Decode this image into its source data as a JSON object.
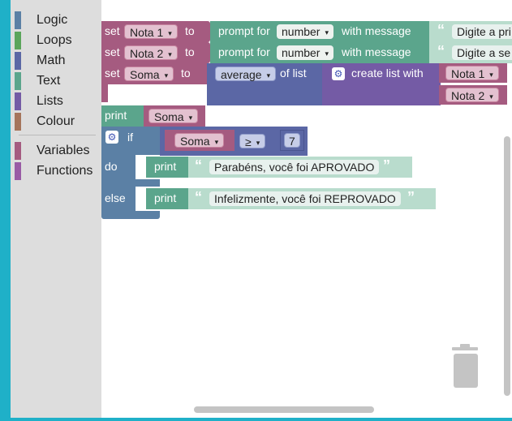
{
  "toolbox": {
    "categories": [
      {
        "label": "Logic",
        "color": "#5b80a5"
      },
      {
        "label": "Loops",
        "color": "#5ba55b"
      },
      {
        "label": "Math",
        "color": "#5b67a5"
      },
      {
        "label": "Text",
        "color": "#5ba58c"
      },
      {
        "label": "Lists",
        "color": "#745ba5"
      },
      {
        "label": "Colour",
        "color": "#a5745b"
      },
      {
        "label": "Variables",
        "color": "#a55b80"
      },
      {
        "label": "Functions",
        "color": "#995ba5"
      }
    ]
  },
  "blocks": {
    "set1": {
      "set": "set",
      "var": "Nota 1",
      "to": "to",
      "prompt": "prompt for",
      "type": "number",
      "with_message": "with message",
      "message": "Digite a pri"
    },
    "set2": {
      "set": "set",
      "var": "Nota 2",
      "to": "to",
      "prompt": "prompt for",
      "type": "number",
      "with_message": "with message",
      "message": "Digite a se"
    },
    "set3": {
      "set": "set",
      "var": "Soma",
      "to": "to",
      "func": "average",
      "of_list": "of list",
      "create_list": "create list with",
      "item1": "Nota 1",
      "item2": "Nota 2"
    },
    "print1": {
      "print": "print",
      "var": "Soma"
    },
    "if_block": {
      "if": "if",
      "var": "Soma",
      "op": "≥",
      "value": "7",
      "do": "do",
      "else": "else",
      "print_do": "print",
      "text_do": "Parabéns, você foi APROVADO",
      "print_else": "print",
      "text_else": "Infelizmente, você foi REPROVADO"
    }
  },
  "glyphs": {
    "dropdown": "▾",
    "quote_open": "“",
    "quote_close": "”",
    "gear": "⚙"
  },
  "colors": {
    "variables": "#a55b80",
    "text": "#5ba58c",
    "math": "#5b67a5",
    "lists": "#745ba5",
    "logic": "#5b80a5",
    "accent": "#1fb0c8"
  }
}
